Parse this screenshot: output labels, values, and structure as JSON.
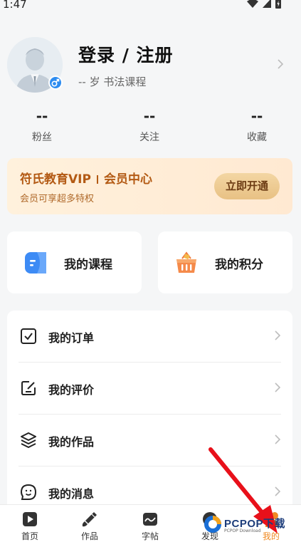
{
  "status": {
    "time": "1:47"
  },
  "profile": {
    "name": "登录 / 注册",
    "subtitle": "-- 岁 书法课程",
    "gender_symbol": "♂"
  },
  "stats": [
    {
      "value": "--",
      "label": "粉丝"
    },
    {
      "value": "--",
      "label": "关注"
    },
    {
      "value": "--",
      "label": "收藏"
    }
  ],
  "vip": {
    "title_left": "符氏教育VIP",
    "title_right": "会员中心",
    "subtitle": "会员可享超多特权",
    "button": "立即开通"
  },
  "quick": [
    {
      "label": "我的课程",
      "icon": "course-icon"
    },
    {
      "label": "我的积分",
      "icon": "points-basket-icon"
    }
  ],
  "menu": [
    {
      "label": "我的订单",
      "icon": "order-check-icon"
    },
    {
      "label": "我的评价",
      "icon": "review-edit-icon"
    },
    {
      "label": "我的作品",
      "icon": "works-layers-icon"
    },
    {
      "label": "我的消息",
      "icon": "message-smile-icon"
    }
  ],
  "tabs": [
    {
      "label": "首页",
      "icon": "home-play-icon"
    },
    {
      "label": "作品",
      "icon": "brush-icon"
    },
    {
      "label": "字帖",
      "icon": "copybook-icon"
    },
    {
      "label": "发现",
      "icon": "discover-icon"
    },
    {
      "label": "我的",
      "icon": "profile-icon",
      "active": true
    }
  ],
  "watermark": {
    "brand": "PCPOP下载",
    "sub": "PCPOP Download"
  },
  "colors": {
    "accent": "#f08a24",
    "vip_text": "#b35a14",
    "link_blue": "#2d8cf0"
  }
}
